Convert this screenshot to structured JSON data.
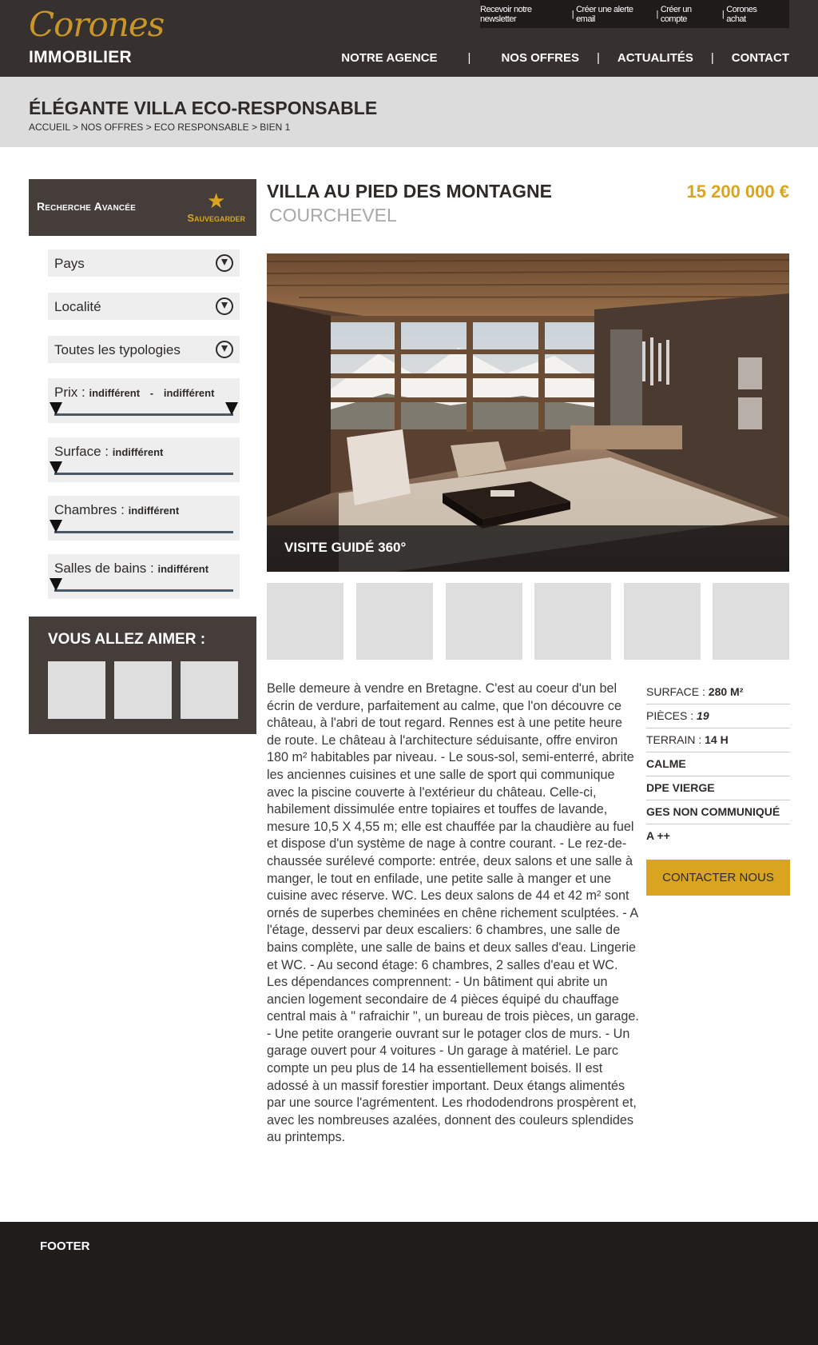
{
  "header": {
    "logo_script": "Corones",
    "logo_sub": "IMMOBILIER",
    "top_links": [
      "Recevoir notre newsletter",
      "Créer une alerte email",
      "Créer un compte",
      "Corones achat"
    ],
    "nav": [
      "NOTRE AGENCE",
      "NOS OFFRES",
      "ACTUALITÉS",
      "CONTACT"
    ]
  },
  "page": {
    "title": "ÉLÉGANTE VILLA ECO-RESPONSABLE",
    "breadcrumb": "ACCUEIL > NOS OFFRES > ECO RESPONSABLE > BIEN 1"
  },
  "sidebar": {
    "search_title": "Recherche Avancée",
    "save_label": "Sauvegarder",
    "selects": [
      "Pays",
      "Localité",
      "Toutes les typologies"
    ],
    "ranges": [
      {
        "label": "Prix :",
        "value": "indifférent",
        "separator": "-",
        "value2": "indifférent"
      },
      {
        "label": "Surface :",
        "value": "indifférent"
      },
      {
        "label": "Chambres :",
        "value": "indifférent"
      },
      {
        "label": "Salles de bains :",
        "value": "indifférent"
      }
    ],
    "like_title": "VOUS ALLEZ AIMER :"
  },
  "property": {
    "title": "VILLA AU PIED DES MONTAGNE",
    "city": "COURCHEVEL",
    "price": "15 200 000 €",
    "hero_caption": "VISITE GUIDÉ 360°",
    "description": "Belle demeure à vendre en Bretagne. C'est au coeur d'un bel écrin de verdure, parfaitement au calme, que l'on découvre ce château, à l'abri de tout regard. Rennes est à une petite heure de route. Le château à l'architecture séduisante, offre environ 180 m² habitables par niveau. - Le sous-sol, semi-enterré, abrite les anciennes cuisines et une salle de sport qui communique avec la piscine couverte à l'extérieur du château. Celle-ci, habilement dissimulée entre topiaires et touffes de lavande, mesure 10,5 X 4,55 m; elle est chauffée par la chaudière au fuel et dispose d'un système de nage à contre courant. - Le rez-de-chaussée surélevé comporte: entrée, deux salons et une salle à manger, le tout en enfilade, une petite salle à manger et une cuisine avec réserve. WC. Les deux salons de 44 et 42 m² sont ornés de superbes cheminées en chêne richement sculptées. - A l'étage, desservi par deux escaliers: 6 chambres, une salle de bains complète, une salle de bains et deux salles d'eau. Lingerie et WC. - Au second étage: 6 chambres, 2 salles d'eau et WC. Les dépendances comprennent: - Un bâtiment qui abrite un ancien logement secondaire de 4 pièces équipé du chauffage central mais à \" rafraichir \", un bureau de trois pièces, un garage. - Une petite orangerie ouvrant sur le potager clos de murs. - Un garage ouvert pour 4 voitures - Un garage à matériel. Le parc compte un peu plus de 14 ha essentiellement boisés. Il est adossé à un massif forestier important. Deux étangs alimentés par une source l'agrémentent. Les rhododendrons prospèrent et, avec les nombreuses azalées, donnent des couleurs splendides au printemps.",
    "specs": [
      {
        "key": "SURFACE :",
        "value": "280 M²"
      },
      {
        "key": "PIÈCES :",
        "value": "19"
      },
      {
        "key": "TERRAIN :",
        "value": "14 H"
      },
      {
        "key": "",
        "value": "CALME"
      },
      {
        "key": "",
        "value": "DPE VIERGE"
      },
      {
        "key": "",
        "value": "GES NON COMMUNIQUÉ"
      },
      {
        "key": "",
        "value": "A ++"
      }
    ],
    "contact_label": "CONTACTER NOUS"
  },
  "footer": {
    "label": "FOOTER"
  },
  "colors": {
    "header_bg": "#36302e",
    "accent": "#d9a521",
    "sidebar_dark": "#443d3a",
    "footer_bg": "#1f1c1c"
  }
}
